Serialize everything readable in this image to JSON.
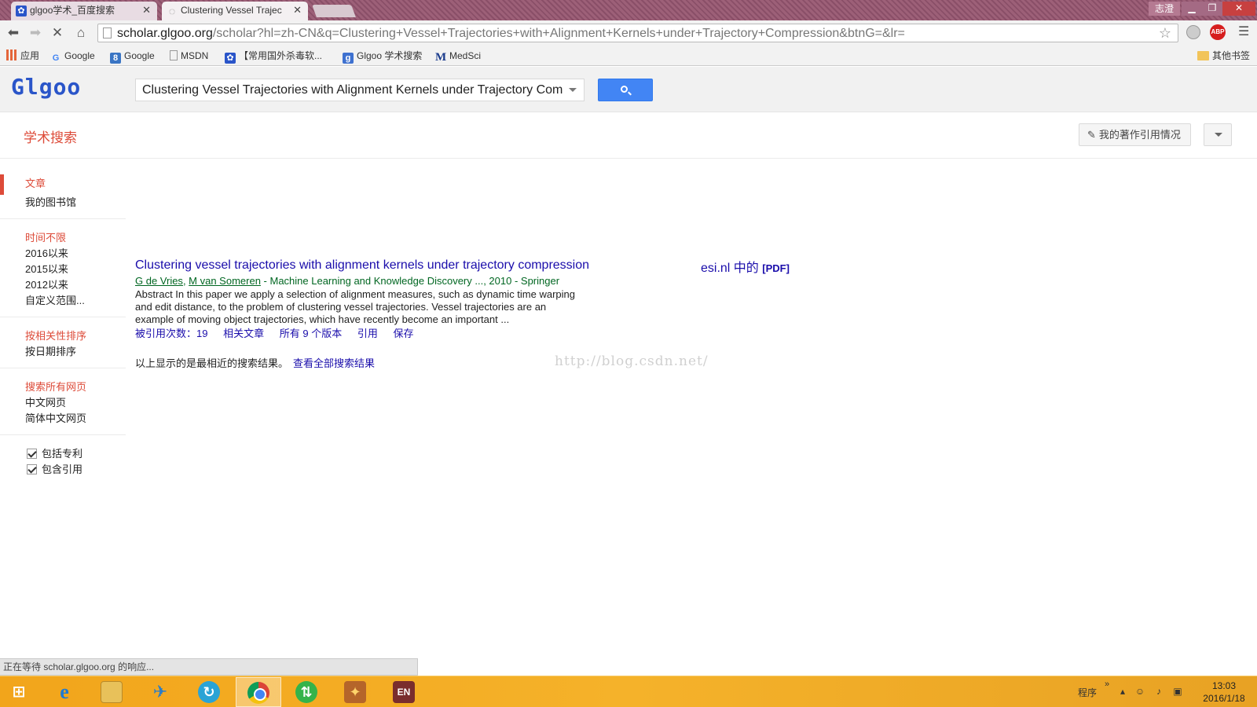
{
  "browser": {
    "tabs": [
      {
        "title": "glgoo学术_百度搜索",
        "icon": "paw-icon"
      },
      {
        "title": "Clustering Vessel Trajec",
        "icon": "loading-icon"
      }
    ],
    "user_name": "志澄",
    "url_host": "scholar.glgoo.org",
    "url_path": "/scholar?hl=zh-CN&q=Clustering+Vessel+Trajectories+with+Alignment+Kernels+under+Trajectory+Compression&btnG=&lr=",
    "bookmarks": [
      {
        "label": "应用",
        "icon": "apps-icon"
      },
      {
        "label": "Google",
        "icon": "google-icon"
      },
      {
        "label": "Google",
        "icon": "google-plus-icon"
      },
      {
        "label": "MSDN",
        "icon": "page-icon"
      },
      {
        "label": "【常用国外杀毒软...",
        "icon": "paw-icon"
      },
      {
        "label": "Glgoo 学术搜索",
        "icon": "glgoo-icon"
      },
      {
        "label": "MedSci",
        "icon": "medsci-icon"
      }
    ],
    "other_bookmarks": "其他书签",
    "abp_label": "ABP"
  },
  "header": {
    "logo": "Glgoo",
    "search_value": "Clustering Vessel Trajectories with Alignment Kernels under Trajectory Com",
    "scholar_title": "学术搜索",
    "my_citations": "我的著作引用情况"
  },
  "sidebar": {
    "group1": [
      "文章",
      "我的图书馆"
    ],
    "time": [
      "时间不限",
      "2016以来",
      "2015以来",
      "2012以来",
      "自定义范围..."
    ],
    "sort": [
      "按相关性排序",
      "按日期排序"
    ],
    "lang": [
      "搜索所有网页",
      "中文网页",
      "简体中文网页"
    ],
    "checks": [
      "包括专利",
      "包含引用"
    ]
  },
  "result": {
    "title": "Clustering vessel trajectories with alignment kernels under trajectory compression",
    "side_source": "esi.nl 中的",
    "side_pdf": "[PDF]",
    "author1": "G de Vries",
    "author2": "M van Someren",
    "meta": " - Machine Learning and Knowledge Discovery ..., 2010 - Springer",
    "snippet": "Abstract In this paper we apply a selection of alignment measures, such as dynamic time warping and edit distance, to the problem of clustering vessel trajectories. Vessel trajectories are an example of moving object trajectories, which have recently become an important ...",
    "links": [
      "被引用次数：19",
      "相关文章",
      "所有 9 个版本",
      "引用",
      "保存"
    ]
  },
  "omitted": {
    "text": "以上显示的是最相近的搜索结果。",
    "link": "查看全部搜索结果"
  },
  "watermark": "http://blog.csdn.net/",
  "status": "正在等待 scholar.glgoo.org 的响应...",
  "taskbar": {
    "tray_label": "程序",
    "time": "13:03",
    "date": "2016/1/18"
  }
}
